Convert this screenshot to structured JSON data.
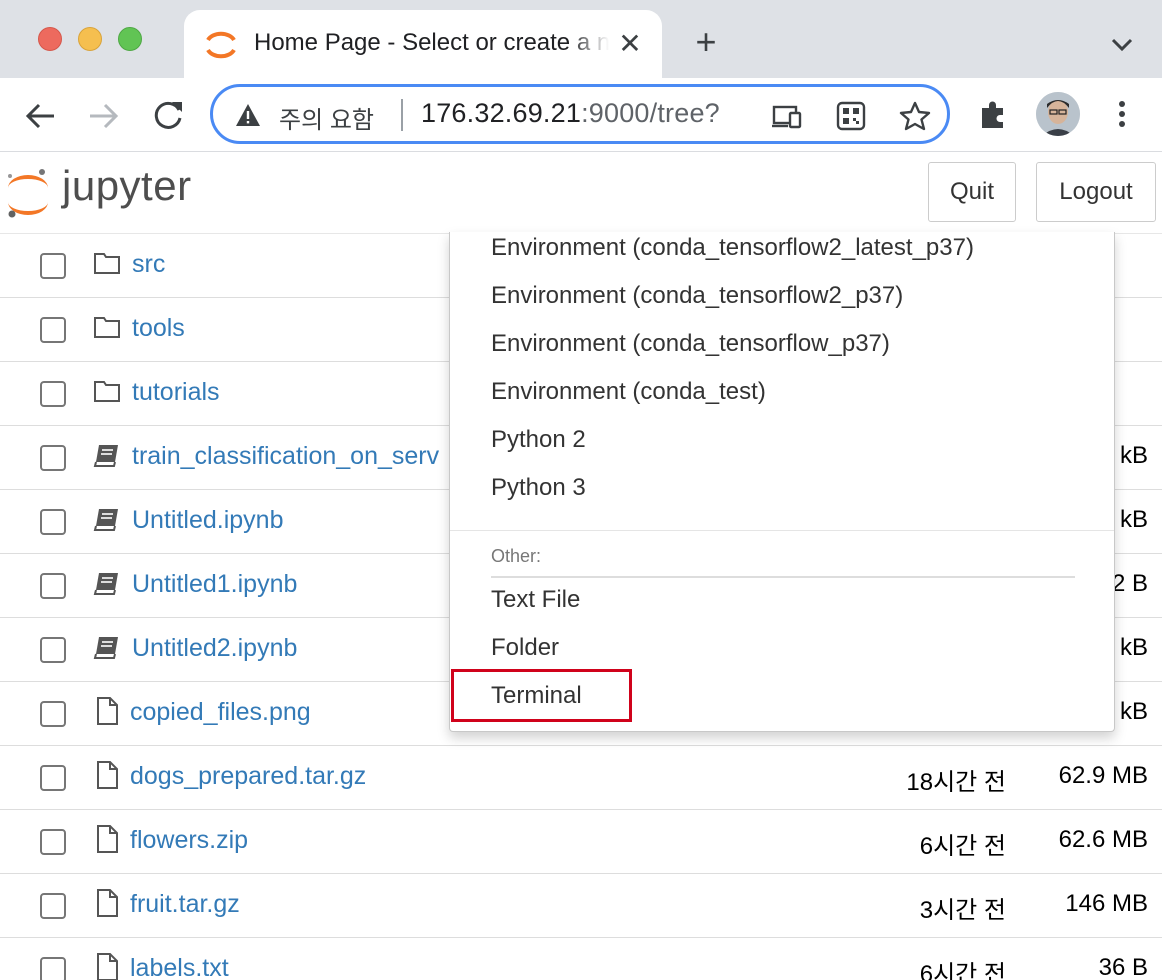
{
  "browser": {
    "tab_title": "Home Page - Select or create a notebook",
    "new_tab": "+",
    "close_tab": "✕",
    "security_label": "주의 요함",
    "url_host": "176.32.69.21",
    "url_rest": ":9000/tree?",
    "icons": [
      "back-icon",
      "forward-icon",
      "reload-icon",
      "warning-icon",
      "cast-icon",
      "qr-code-icon",
      "star-icon",
      "extensions-icon",
      "avatar",
      "more-icon"
    ]
  },
  "jupyter": {
    "logo_text": "jupyter",
    "quit_label": "Quit",
    "logout_label": "Logout"
  },
  "files": [
    {
      "type": "folder",
      "name": "src",
      "modified": "",
      "size": ""
    },
    {
      "type": "folder",
      "name": "tools",
      "modified": "",
      "size": ""
    },
    {
      "type": "folder",
      "name": "tutorials",
      "modified": "",
      "size": ""
    },
    {
      "type": "notebook",
      "name": "train_classification_on_serv",
      "modified": "",
      "size": "kB"
    },
    {
      "type": "notebook",
      "name": "Untitled.ipynb",
      "modified": "",
      "size": "kB"
    },
    {
      "type": "notebook",
      "name": "Untitled1.ipynb",
      "modified": "",
      "size": "2 B"
    },
    {
      "type": "notebook",
      "name": "Untitled2.ipynb",
      "modified": "",
      "size": "kB"
    },
    {
      "type": "file",
      "name": "copied_files.png",
      "modified": "",
      "size": "kB"
    },
    {
      "type": "file",
      "name": "dogs_prepared.tar.gz",
      "modified": "18시간 전",
      "size": "62.9 MB"
    },
    {
      "type": "file",
      "name": "flowers.zip",
      "modified": "6시간 전",
      "size": "62.6 MB"
    },
    {
      "type": "file",
      "name": "fruit.tar.gz",
      "modified": "3시간 전",
      "size": "146 MB"
    },
    {
      "type": "file",
      "name": "labels.txt",
      "modified": "6시간 전",
      "size": "36 B"
    }
  ],
  "dropdown": {
    "kernels": [
      "Environment (conda_tensorflow2_latest_p37)",
      "Environment (conda_tensorflow2_p37)",
      "Environment (conda_tensorflow_p37)",
      "Environment (conda_test)",
      "Python 2",
      "Python 3"
    ],
    "other_header": "Other:",
    "other_items": [
      "Text File",
      "Folder",
      "Terminal"
    ],
    "highlighted_item": "Terminal",
    "highlight_color": "#d0021b"
  }
}
